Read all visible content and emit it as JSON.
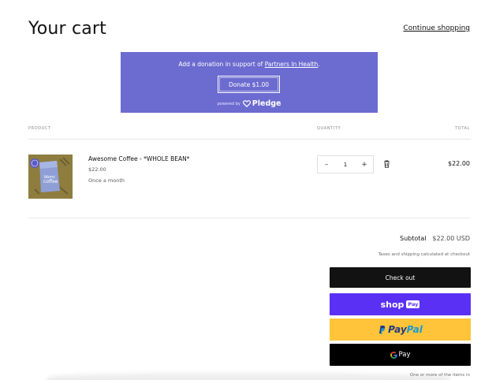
{
  "header": {
    "title": "Your cart",
    "continue_label": "Continue shopping"
  },
  "donation": {
    "text_prefix": "Add a donation in support of ",
    "charity": "Partners In Health",
    "text_suffix": ".",
    "button_label": "Donate $1.00",
    "powered_by": "powered by",
    "brand": "Pledge",
    "bg_color": "#6b6bd0"
  },
  "table": {
    "headers": {
      "product": "PRODUCT",
      "quantity": "QUANTITY",
      "total": "TOTAL"
    }
  },
  "items": [
    {
      "name": "Awesome Coffee - *WHOLE BEAN*",
      "price": "$22.00",
      "frequency": "Once a month",
      "quantity": "1",
      "total": "$22.00",
      "image_label": "coffee bag"
    }
  ],
  "summary": {
    "subtotal_label": "Subtotal",
    "subtotal_value": "$22.00 USD",
    "taxes_note": "Taxes and shipping calculated at checkout",
    "checkout_label": "Check out",
    "shop_word": "shop",
    "shop_badge": "Pay",
    "paypal_1": "Pay",
    "paypal_2": "Pal",
    "gpay_label": "Pay",
    "bottom_note": "One or more of the items in"
  },
  "colors": {
    "shop_pay": "#5a31f4",
    "paypal": "#ffc439",
    "checkout": "#121212"
  }
}
